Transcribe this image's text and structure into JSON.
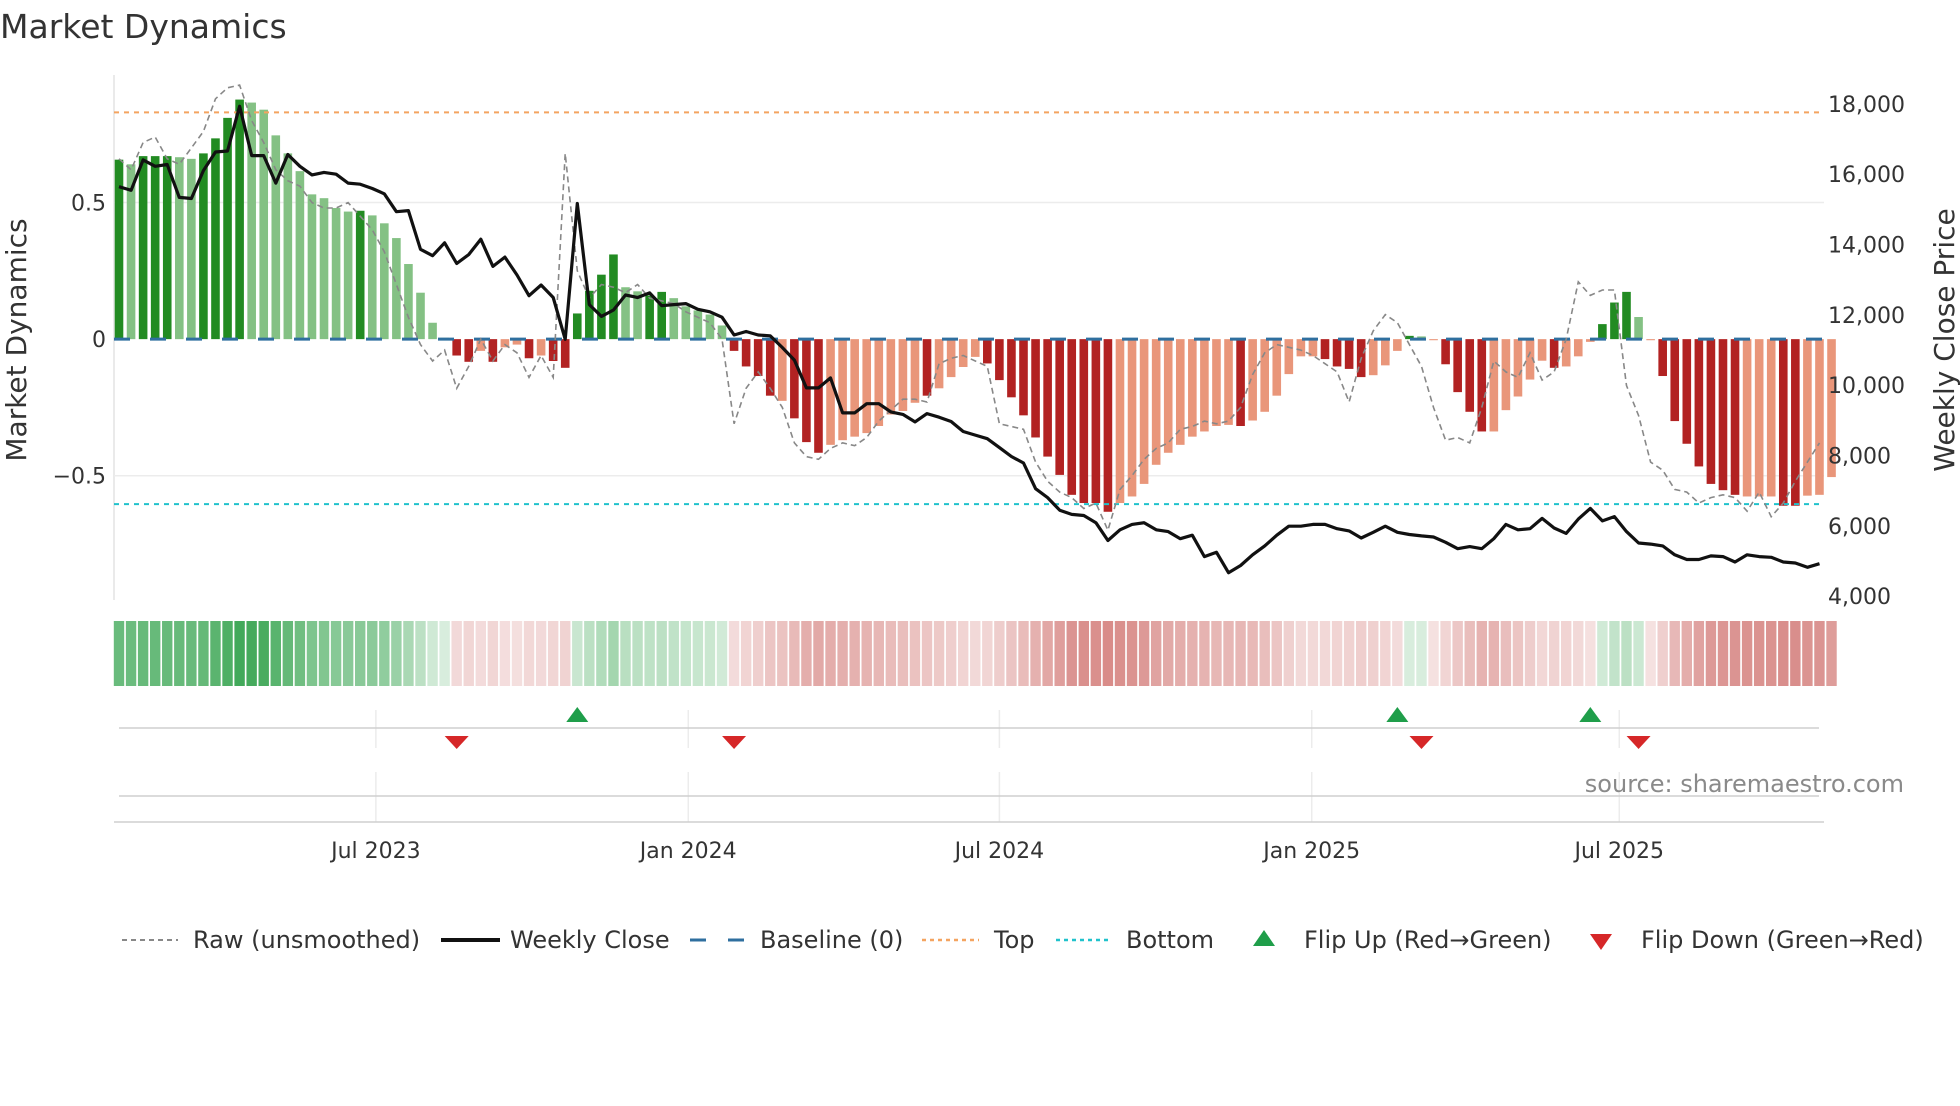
{
  "title": "Market Dynamics",
  "source": "source: sharemaestro.com",
  "chart_data": {
    "type": "bar",
    "title": "Market Dynamics",
    "ylabel": "Market Dynamics",
    "y2label": "Weekly Close Price",
    "ylim": [
      -0.955,
      0.945
    ],
    "y2lim": [
      3890,
      18650
    ],
    "yticks": [
      {
        "v": 0.5,
        "label": "0.5"
      },
      {
        "v": 0,
        "label": "0"
      },
      {
        "v": -0.5,
        "label": "−0.5"
      }
    ],
    "y2ticks": [
      {
        "v": 4000,
        "label": "4,000"
      },
      {
        "v": 6000,
        "label": "6,000"
      },
      {
        "v": 8000,
        "label": "8,000"
      },
      {
        "v": 10000,
        "label": "10,000"
      },
      {
        "v": 12000,
        "label": "12,000"
      },
      {
        "v": 14000,
        "label": "14,000"
      },
      {
        "v": 16000,
        "label": "16,000"
      },
      {
        "v": 18000,
        "label": "18,000"
      }
    ],
    "xticks": [
      {
        "week": 21.3,
        "label": "Jul 2023"
      },
      {
        "week": 47.2,
        "label": "Jan 2024"
      },
      {
        "week": 73.0,
        "label": "Jul 2024"
      },
      {
        "week": 98.9,
        "label": "Jan 2025"
      },
      {
        "week": 124.4,
        "label": "Jul 2025"
      }
    ],
    "top_level": 0.83,
    "bottom_level": -0.604,
    "baseline": 0,
    "momentum": [
      0.657,
      0.64,
      0.67,
      0.67,
      0.67,
      0.666,
      0.66,
      0.68,
      0.735,
      0.81,
      0.877,
      0.866,
      0.84,
      0.746,
      0.68,
      0.615,
      0.53,
      0.516,
      0.48,
      0.467,
      0.47,
      0.453,
      0.424,
      0.37,
      0.275,
      0.17,
      0.06,
      0.005,
      -0.06,
      -0.083,
      -0.043,
      -0.083,
      -0.03,
      -0.02,
      -0.07,
      -0.06,
      -0.08,
      -0.105,
      0.094,
      0.177,
      0.236,
      0.31,
      0.19,
      0.175,
      0.16,
      0.173,
      0.15,
      0.12,
      0.105,
      0.09,
      0.05,
      -0.043,
      -0.1,
      -0.135,
      -0.207,
      -0.226,
      -0.29,
      -0.377,
      -0.416,
      -0.387,
      -0.37,
      -0.357,
      -0.344,
      -0.318,
      -0.276,
      -0.263,
      -0.233,
      -0.207,
      -0.18,
      -0.139,
      -0.102,
      -0.065,
      -0.089,
      -0.15,
      -0.213,
      -0.279,
      -0.36,
      -0.43,
      -0.497,
      -0.57,
      -0.6,
      -0.6,
      -0.632,
      -0.6,
      -0.576,
      -0.53,
      -0.46,
      -0.416,
      -0.387,
      -0.357,
      -0.338,
      -0.318,
      -0.314,
      -0.318,
      -0.298,
      -0.266,
      -0.207,
      -0.128,
      -0.063,
      -0.063,
      -0.073,
      -0.1,
      -0.109,
      -0.139,
      -0.132,
      -0.096,
      -0.043,
      0.012,
      0.01,
      -0.004,
      -0.092,
      -0.194,
      -0.266,
      -0.338,
      -0.338,
      -0.26,
      -0.21,
      -0.148,
      -0.079,
      -0.105,
      -0.1,
      -0.063,
      -0.01,
      0.055,
      0.134,
      0.173,
      0.081,
      -0.004,
      -0.135,
      -0.3,
      -0.383,
      -0.466,
      -0.53,
      -0.553,
      -0.57,
      -0.576,
      -0.576,
      -0.576,
      -0.61,
      -0.61,
      -0.573,
      -0.57,
      -0.505
    ],
    "strong": "DLDDDLLDDDDLLLLLLLLLDLLLLLLLDDLDLLDLDDDDDDLLDDLLLLLDDDDLDDDLLLLLLLLDLLLLDDDDDDDDDDDLLLLLLLLLLDLLLLLLDDDDLLLDLLDDDDLLLLLDLLLDDDLLDDDDDDDLLLDDLLL",
    "raw": [
      0.66,
      0.62,
      0.72,
      0.74,
      0.66,
      0.64,
      0.7,
      0.76,
      0.88,
      0.92,
      0.93,
      0.8,
      0.72,
      0.62,
      0.58,
      0.56,
      0.5,
      0.48,
      0.48,
      0.5,
      0.45,
      0.4,
      0.32,
      0.2,
      0.08,
      -0.02,
      -0.08,
      -0.04,
      -0.18,
      -0.1,
      0.0,
      -0.08,
      -0.02,
      -0.05,
      -0.14,
      -0.06,
      -0.14,
      0.68,
      0.25,
      0.15,
      0.2,
      0.19,
      0.17,
      0.2,
      0.15,
      0.14,
      0.13,
      0.1,
      0.08,
      0.06,
      0.0,
      -0.31,
      -0.18,
      -0.12,
      -0.18,
      -0.25,
      -0.38,
      -0.43,
      -0.44,
      -0.4,
      -0.38,
      -0.39,
      -0.36,
      -0.3,
      -0.26,
      -0.22,
      -0.22,
      -0.23,
      -0.09,
      -0.07,
      -0.06,
      -0.08,
      -0.1,
      -0.31,
      -0.32,
      -0.33,
      -0.45,
      -0.52,
      -0.56,
      -0.58,
      -0.62,
      -0.6,
      -0.7,
      -0.55,
      -0.5,
      -0.44,
      -0.4,
      -0.38,
      -0.33,
      -0.32,
      -0.3,
      -0.31,
      -0.3,
      -0.25,
      -0.13,
      -0.05,
      -0.02,
      -0.03,
      -0.04,
      -0.06,
      -0.09,
      -0.12,
      -0.23,
      -0.07,
      0.03,
      0.09,
      0.06,
      -0.02,
      -0.1,
      -0.25,
      -0.37,
      -0.36,
      -0.38,
      -0.25,
      -0.08,
      -0.12,
      -0.14,
      -0.05,
      -0.15,
      -0.12,
      0.0,
      0.21,
      0.16,
      0.18,
      0.18,
      -0.17,
      -0.28,
      -0.45,
      -0.48,
      -0.55,
      -0.56,
      -0.6,
      -0.58,
      -0.57,
      -0.58,
      -0.63,
      -0.56,
      -0.65,
      -0.6,
      -0.52,
      -0.45,
      -0.38
    ],
    "close": [
      15644,
      15542,
      16406,
      16223,
      16274,
      15339,
      15308,
      16101,
      16630,
      16660,
      17931,
      16528,
      16528,
      15745,
      16559,
      16223,
      15979,
      16050,
      15999,
      15745,
      15715,
      15593,
      15441,
      14932,
      14963,
      13865,
      13682,
      14048,
      13459,
      13713,
      14150,
      13377,
      13642,
      13133,
      12543,
      12849,
      12493,
      11304,
      15166,
      12290,
      11954,
      12137,
      12564,
      12493,
      12625,
      12259,
      12290,
      12320,
      12158,
      12087,
      11934,
      11426,
      11527,
      11426,
      11405,
      11070,
      10714,
      9921,
      9921,
      10206,
      9210,
      9210,
      9474,
      9474,
      9240,
      9169,
      8956,
      9190,
      9088,
      8966,
      8681,
      8580,
      8478,
      8224,
      7970,
      7787,
      7055,
      6801,
      6445,
      6323,
      6292,
      6089,
      5581,
      5886,
      6039,
      6089,
      5886,
      5835,
      5632,
      5734,
      5124,
      5246,
      4667,
      4870,
      5175,
      5429,
      5734,
      5988,
      5988,
      6039,
      6039,
      5917,
      5856,
      5652,
      5815,
      5988,
      5815,
      5754,
      5713,
      5683,
      5531,
      5348,
      5409,
      5348,
      5632,
      6039,
      5886,
      5917,
      6211,
      5937,
      5785,
      6191,
      6496,
      6140,
      6262,
      5835,
      5510,
      5480,
      5429,
      5175,
      5043,
      5043,
      5144,
      5124,
      4972,
      5175,
      5124,
      5104,
      4972,
      4941,
      4819,
      4921
    ],
    "flip_up": [
      38,
      106,
      122
    ],
    "flip_down": [
      28,
      51,
      108,
      126
    ],
    "legend": {
      "placement": "bottom",
      "raw": "Raw (unsmoothed)",
      "close": "Weekly Close",
      "baseline": "Baseline (0)",
      "top": "Top",
      "bottom": "Bottom",
      "flip_up": "Flip Up (Red→Green)",
      "flip_down": "Flip Down (Green→Red)"
    },
    "colors": {
      "green_strong": "#228b22",
      "green_weak": "#84c184",
      "red_strong": "#b22222",
      "red_weak": "#e9967a",
      "baseline": "#2f6f9f",
      "top": "#f4a460",
      "bottom": "#20c2cc",
      "raw": "#888888",
      "close": "#111111",
      "flip_up": "#1f9e4a",
      "flip_down": "#d62728"
    }
  }
}
